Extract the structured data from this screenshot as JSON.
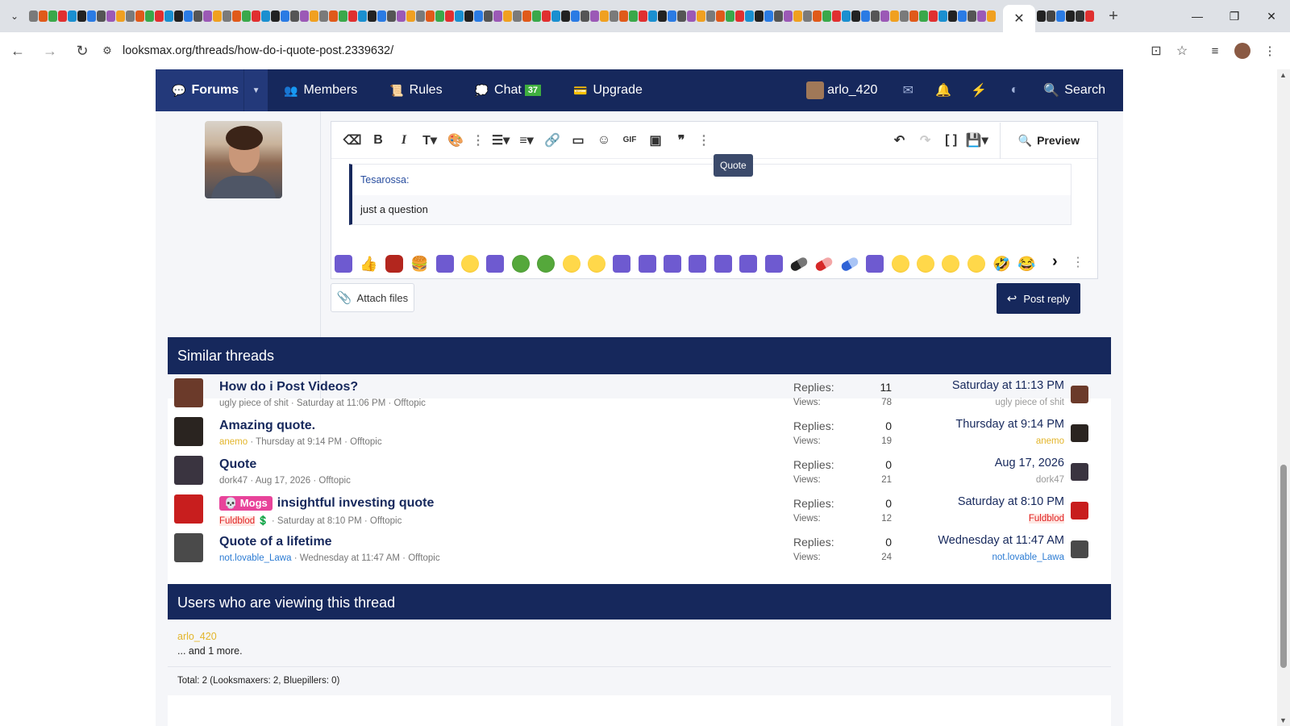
{
  "browser": {
    "tab_close": "✕",
    "new_tab": "+",
    "url": "looksmax.org/threads/how-do-i-quote-post.2339632/",
    "window_controls": [
      "—",
      "❐",
      "✕"
    ]
  },
  "nav": {
    "forums": "Forums",
    "members": "Members",
    "rules": "Rules",
    "chat": "Chat",
    "chat_badge": "37",
    "upgrade": "Upgrade",
    "username": "arlo_420",
    "search": "Search"
  },
  "editor": {
    "tooltip": "Quote",
    "preview": "Preview",
    "quote_author": "Tesarossa:",
    "quote_text": "just a question",
    "attach": "Attach files",
    "post_reply": "Post reply"
  },
  "similar": {
    "heading": "Similar threads",
    "replies_label": "Replies:",
    "views_label": "Views:",
    "threads": [
      {
        "title": "How do i Post Videos?",
        "prefix": "",
        "author": "ugly piece of shit",
        "meta": " · Saturday at 11:06 PM · Offtopic",
        "replies": "11",
        "views": "78",
        "last_date": "Saturday at 11:13 PM",
        "last_user": "ugly piece of shit",
        "av_color": "#6b3a2a"
      },
      {
        "title": "Amazing quote.",
        "prefix": "",
        "author": "anemo",
        "meta": " · Thursday at 9:14 PM · Offtopic",
        "replies": "0",
        "views": "19",
        "last_date": "Thursday at 9:14 PM",
        "last_user": "anemo",
        "av_color": "#2a2420"
      },
      {
        "title": "Quote",
        "prefix": "",
        "author": "dork47",
        "meta": " · Aug 17, 2026 · Offtopic",
        "replies": "0",
        "views": "21",
        "last_date": "Aug 17, 2026",
        "last_user": "dork47",
        "av_color": "#3a3440"
      },
      {
        "title": "insightful investing quote",
        "prefix": "💀 Mogs",
        "author": "Fuldblod",
        "meta": " 💲 · Saturday at 8:10 PM · Offtopic",
        "replies": "0",
        "views": "12",
        "last_date": "Saturday at 8:10 PM",
        "last_user": "Fuldblod",
        "av_color": "#c81e1e"
      },
      {
        "title": "Quote of a lifetime",
        "prefix": "",
        "author": "not.lovable_Lawa",
        "meta": " · Wednesday at 11:47 AM · Offtopic",
        "replies": "0",
        "views": "24",
        "last_date": "Wednesday at 11:47 AM",
        "last_user": "not.lovable_Lawa",
        "av_color": "#4a4a4a"
      }
    ]
  },
  "viewers": {
    "heading": "Users who are viewing this thread",
    "user": "arlo_420",
    "more": "... and 1 more.",
    "total": "Total: 2 (Looksmaxers: 2, Bluepillers: 0)"
  }
}
